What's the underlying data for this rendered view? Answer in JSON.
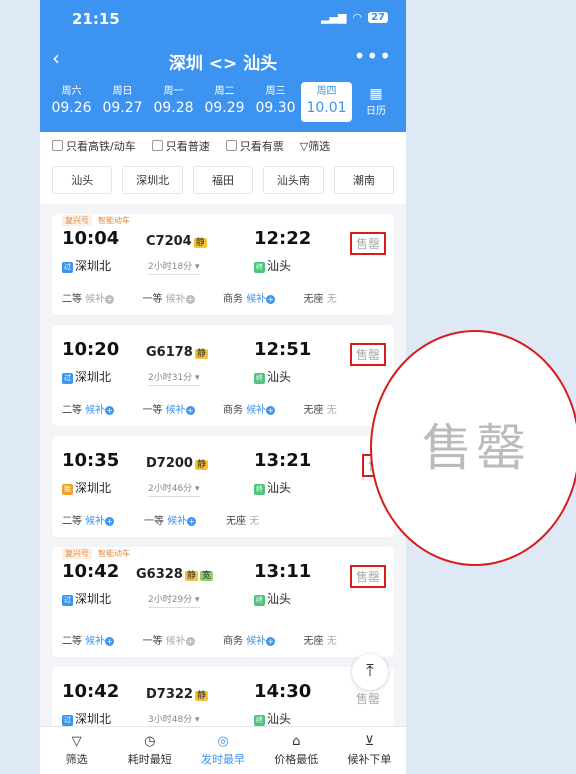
{
  "status": {
    "time": "21:15",
    "battery": "27"
  },
  "nav": {
    "title": "深圳 <> 汕头",
    "more": "•••"
  },
  "dates": [
    {
      "weekday": "周六",
      "date": "09.26"
    },
    {
      "weekday": "周日",
      "date": "09.27"
    },
    {
      "weekday": "周一",
      "date": "09.28"
    },
    {
      "weekday": "周二",
      "date": "09.29"
    },
    {
      "weekday": "周三",
      "date": "09.30"
    },
    {
      "weekday": "周四",
      "date": "10.01"
    }
  ],
  "calendar_label": "日历",
  "filters": {
    "high_speed": "只看高铁/动车",
    "normal": "只看普速",
    "available": "只看有票",
    "filter": "筛选"
  },
  "stations": [
    "汕头",
    "深圳北",
    "福田",
    "汕头南",
    "潮南"
  ],
  "trains": [
    {
      "tag1": "复兴号",
      "tag2": "智能动车",
      "dep": "10:04",
      "num": "C7204",
      "flag": "静",
      "arr": "12:22",
      "status": "售罄",
      "from_icon": "过",
      "from": "深圳北",
      "duration": "2小时18分",
      "to_icon": "终",
      "to": "汕头",
      "seats": [
        {
          "name": "二等",
          "val": "候补",
          "plus": true
        },
        {
          "name": "一等",
          "val": "候补",
          "plus": true
        },
        {
          "name": "商务",
          "val": "候补",
          "plus": true
        },
        {
          "name": "无座",
          "val": "无"
        }
      ]
    },
    {
      "tag1": "",
      "tag2": "",
      "dep": "10:20",
      "num": "G6178",
      "flag": "静",
      "arr": "12:51",
      "status": "售罄",
      "from_icon": "过",
      "from": "深圳北",
      "duration": "2小时31分",
      "to_icon": "终",
      "to": "汕头",
      "seats": [
        {
          "name": "二等",
          "val": "候补",
          "plus": true
        },
        {
          "name": "一等",
          "val": "候补",
          "plus": true
        },
        {
          "name": "商务",
          "val": "候补",
          "plus": true
        },
        {
          "name": "无座",
          "val": "无"
        }
      ]
    },
    {
      "tag1": "",
      "tag2": "",
      "dep": "10:35",
      "num": "D7200",
      "flag": "静",
      "arr": "13:21",
      "status": "售",
      "from_icon": "始",
      "from": "深圳北",
      "duration": "2小时46分",
      "to_icon": "终",
      "to": "汕头",
      "seats": [
        {
          "name": "二等",
          "val": "候补",
          "plus": true
        },
        {
          "name": "一等",
          "val": "候补",
          "plus": true
        },
        {
          "name": "无座",
          "val": "无"
        }
      ]
    },
    {
      "tag1": "复兴号",
      "tag2": "智能动车",
      "dep": "10:42",
      "num": "G6328",
      "flag": "静",
      "flag2": "宽",
      "arr": "13:11",
      "status": "售罄",
      "from_icon": "过",
      "from": "深圳北",
      "duration": "2小时29分",
      "to_icon": "终",
      "to": "汕头",
      "seats": [
        {
          "name": "二等",
          "val": "候补",
          "plus": true
        },
        {
          "name": "一等",
          "val": "候补",
          "plus": true
        },
        {
          "name": "商务",
          "val": "候补",
          "plus": true
        },
        {
          "name": "无座",
          "val": "无"
        }
      ]
    },
    {
      "tag1": "",
      "tag2": "",
      "dep": "10:42",
      "num": "D7322",
      "flag": "静",
      "arr": "14:30",
      "status": "售罄",
      "from_icon": "过",
      "from": "深圳北",
      "duration": "3小时48分",
      "to_icon": "终",
      "to": "汕头",
      "seats": []
    }
  ],
  "tabs": [
    "筛选",
    "耗时最短",
    "发时最早",
    "价格最低",
    "候补下单"
  ],
  "zoom_text": "售罄"
}
